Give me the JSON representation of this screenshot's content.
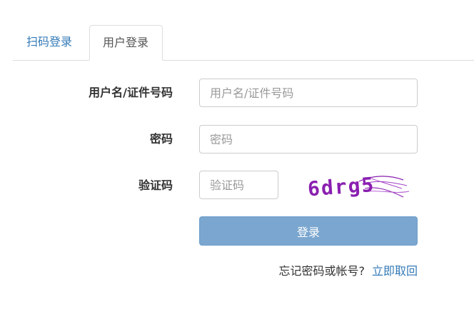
{
  "tabs": {
    "scan_login": "扫码登录",
    "user_login": "用户登录"
  },
  "form": {
    "username_label": "用户名/证件号码",
    "username_placeholder": "用户名/证件号码",
    "password_label": "密码",
    "password_placeholder": "密码",
    "captcha_label": "验证码",
    "captcha_placeholder": "验证码",
    "captcha_text": "6drg5",
    "login_button": "登录"
  },
  "footer": {
    "forgot_text": "忘记密码或帐号?",
    "recover_link": "立即取回"
  },
  "colors": {
    "accent": "#337ab7",
    "button": "#7aa6cf",
    "captcha": "#8a1fb0"
  }
}
